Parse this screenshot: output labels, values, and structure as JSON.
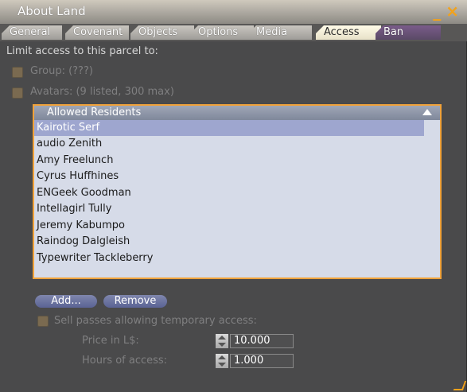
{
  "window": {
    "title": "About Land"
  },
  "tabs": [
    {
      "label": "General"
    },
    {
      "label": "Covenant"
    },
    {
      "label": "Objects"
    },
    {
      "label": "Options"
    },
    {
      "label": "Media"
    },
    {
      "label": "Access"
    },
    {
      "label": "Ban"
    }
  ],
  "active_tab": "Access",
  "access": {
    "limit_label": "Limit access to this parcel to:",
    "group_label": "Group: (???)",
    "avatars_label": "Avatars: (9 listed, 300 max)",
    "list_header": "Allowed Residents",
    "residents": [
      "Kairotic Serf",
      "audio Zenith",
      "Amy Freelunch",
      "Cyrus Huffhines",
      "ENGeek Goodman",
      "Intellagirl Tully",
      "Jeremy Kabumpo",
      "Raindog Dalgleish",
      "Typewriter Tackleberry"
    ],
    "selected_resident": "Kairotic Serf",
    "add_button": "Add...",
    "remove_button": "Remove",
    "sell_passes_label": "Sell passes allowing temporary access:",
    "price_label": "Price in L$:",
    "price_value": "10.000",
    "hours_label": "Hours of access:",
    "hours_value": "1.000"
  },
  "colors": {
    "accent": "#f2a21b",
    "list_border": "#f0a23a",
    "selection": "#9ea6cf"
  }
}
